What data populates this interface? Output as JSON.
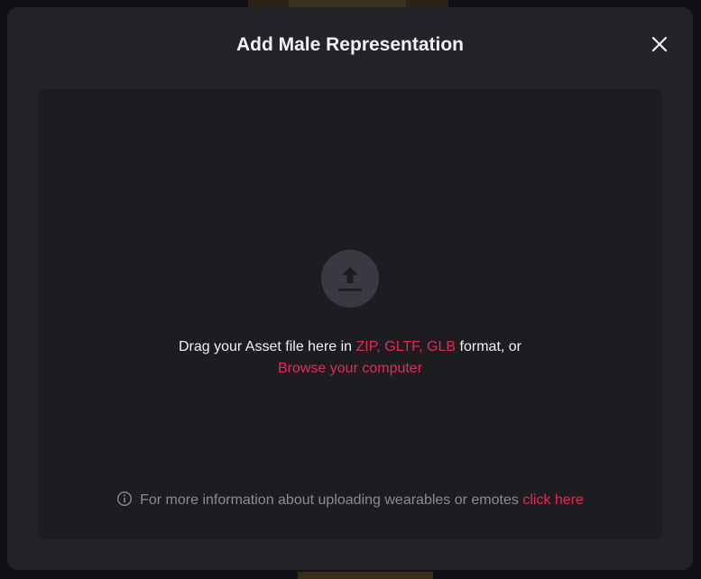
{
  "modal": {
    "title": "Add Male Representation"
  },
  "dropzone": {
    "text_before": "Drag your Asset file here in ",
    "formats": "ZIP, GLTF, GLB",
    "text_after": " format, or",
    "browse_label": "Browse your computer"
  },
  "info": {
    "text": "For more information about uploading wearables or emotes ",
    "link_label": "click here"
  },
  "colors": {
    "accent": "#e52957",
    "modal_bg": "#242328",
    "dropzone_bg": "#1d1c21",
    "text_primary": "#f2f1f4",
    "text_muted": "#8c8a93"
  },
  "icons": {
    "close": "close-icon",
    "upload": "upload-icon",
    "info": "info-icon"
  }
}
